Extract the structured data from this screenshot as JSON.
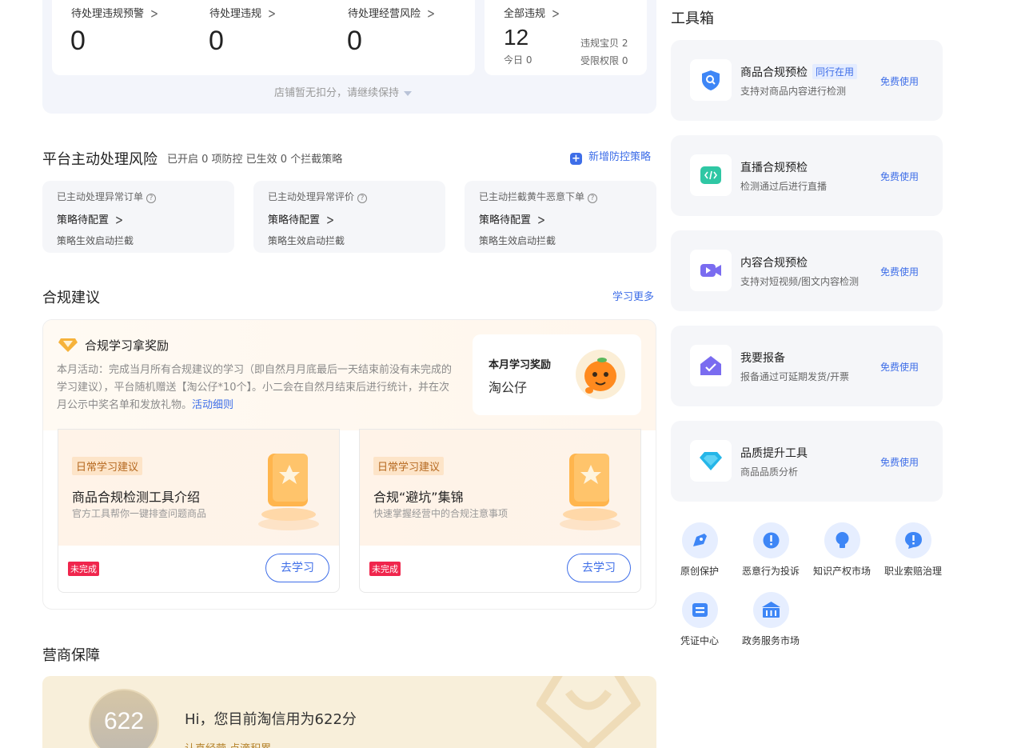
{
  "stats": {
    "items": [
      {
        "label": "待处理违规预警",
        "value": "0"
      },
      {
        "label": "待处理违规",
        "value": "0"
      },
      {
        "label": "待处理经营风险",
        "value": "0"
      }
    ],
    "all_violations": {
      "label": "全部违规",
      "value": "12",
      "today": "今日 0",
      "items_violation": "违规宝贝 2",
      "restricted": "受限权限 0"
    },
    "tip": "店铺暂无扣分，请继续保持"
  },
  "platform_risk": {
    "title": "平台主动处理风险",
    "subtitle": "已开启 0 项防控 已生效 0 个拦截策略",
    "add_link": "新增防控策略",
    "cards": [
      {
        "title": "已主动处理异常订单",
        "status": "策略待配置",
        "desc": "策略生效启动拦截"
      },
      {
        "title": "已主动处理异常评价",
        "status": "策略待配置",
        "desc": "策略生效启动拦截"
      },
      {
        "title": "已主动拦截黄牛恶意下单",
        "status": "策略待配置",
        "desc": "策略生效启动拦截"
      }
    ]
  },
  "compliance": {
    "title": "合规建议",
    "more_link": "学习更多",
    "reward_title": "合规学习拿奖励",
    "reward_desc": "本月活动：完成当月所有合规建议的学习（即自然月月底最后一天结束前没有未完成的学习建议），平台随机赠送【淘公仔*10个】。小二会在自然月结束后进行统计，并在次月公示中奖名单和发放礼物。",
    "reward_link": "活动细则",
    "month_card": {
      "title": "本月学习奖励",
      "prize": "淘公仔"
    },
    "study_cards": [
      {
        "tag": "日常学习建议",
        "title": "商品合规检测工具介绍",
        "desc": "官方工具帮你一键排查问题商品",
        "badge": "未完成",
        "button": "去学习"
      },
      {
        "tag": "日常学习建议",
        "title": "合规“避坑”集锦",
        "desc": "快速掌握经营中的合规注意事项",
        "badge": "未完成",
        "button": "去学习"
      }
    ]
  },
  "merchant": {
    "title": "营商保障",
    "score": "622",
    "text": "Hi，您目前淘信用为622分",
    "sub": "认真经营 点滴积累"
  },
  "toolbox": {
    "title": "工具箱",
    "tools": [
      {
        "name": "商品合规预检",
        "badge": "同行在用",
        "desc": "支持对商品内容进行检测",
        "action": "免费使用",
        "icon": "shield-search-icon"
      },
      {
        "name": "直播合规预检",
        "badge": "",
        "desc": "检测通过后进行直播",
        "action": "免费使用",
        "icon": "code-icon"
      },
      {
        "name": "内容合规预检",
        "badge": "",
        "desc": "支持对短视频/图文内容检测",
        "action": "免费使用",
        "icon": "video-icon"
      },
      {
        "name": "我要报备",
        "badge": "",
        "desc": "报备通过可延期发货/开票",
        "action": "免费使用",
        "icon": "house-check-icon"
      },
      {
        "name": "品质提升工具",
        "badge": "",
        "desc": "商品品质分析",
        "action": "免费使用",
        "icon": "diamond-icon"
      }
    ],
    "quick_links": [
      {
        "label": "原创保护",
        "icon": "pen-icon"
      },
      {
        "label": "恶意行为投诉",
        "icon": "alert-icon"
      },
      {
        "label": "知识产权市场",
        "icon": "bulb-icon"
      },
      {
        "label": "职业索赔治理",
        "icon": "alert-icon"
      },
      {
        "label": "凭证中心",
        "icon": "ticket-icon"
      },
      {
        "label": "政务服务市场",
        "icon": "bank-icon"
      }
    ]
  },
  "colors": {
    "accent": "#3e6ee8",
    "badge_red": "#f0264d",
    "panel_bg": "#f3f5fb"
  }
}
